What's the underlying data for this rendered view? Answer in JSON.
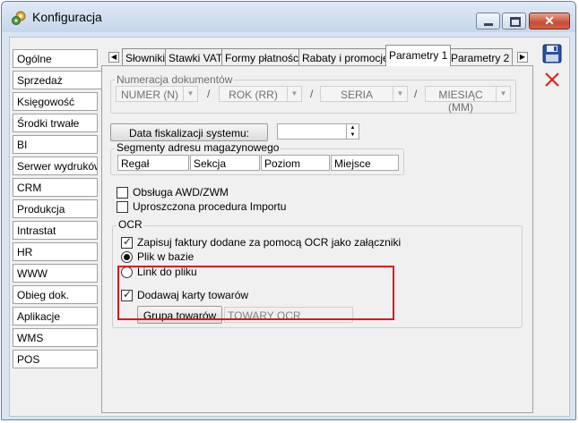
{
  "window": {
    "title": "Konfiguracja",
    "close_label": "✕"
  },
  "sidebar": {
    "items": [
      {
        "label": "Ogólne"
      },
      {
        "label": "Sprzedaż"
      },
      {
        "label": "Księgowość"
      },
      {
        "label": "Środki trwałe"
      },
      {
        "label": "BI"
      },
      {
        "label": "Serwer wydruków"
      },
      {
        "label": "CRM"
      },
      {
        "label": "Produkcja"
      },
      {
        "label": "Intrastat"
      },
      {
        "label": "HR"
      },
      {
        "label": "WWW"
      },
      {
        "label": "Obieg dok."
      },
      {
        "label": "Aplikacje"
      },
      {
        "label": "WMS"
      },
      {
        "label": "POS"
      }
    ],
    "active_index": 1
  },
  "tabs": {
    "prev_arrow": "◀",
    "next_arrow": "▶",
    "items": [
      {
        "label": "Słowniki"
      },
      {
        "label": "Stawki VAT"
      },
      {
        "label": "Formy płatności"
      },
      {
        "label": "Rabaty i promocje"
      },
      {
        "label": "Parametry 1"
      },
      {
        "label": "Parametry 2"
      }
    ],
    "active_index": 4
  },
  "numeracja": {
    "legend": "Numeracja dokumentów",
    "separator": "/",
    "segments": [
      {
        "value": "NUMER (N)"
      },
      {
        "value": "ROK (RR)"
      },
      {
        "value": "SERIA"
      },
      {
        "value": "MIESIĄC (MM)"
      }
    ]
  },
  "fiskalizacja": {
    "button_label": "Data fiskalizacji systemu:",
    "value": ""
  },
  "segmenty": {
    "legend": "Segmenty adresu magazynowego",
    "fields": [
      {
        "value": "Regał"
      },
      {
        "value": "Sekcja"
      },
      {
        "value": "Poziom"
      },
      {
        "value": "Miejsce"
      }
    ]
  },
  "options": {
    "awd_label": "Obsługa AWD/ZWM",
    "awd_checked": false,
    "import_label": "Uproszczona procedura Importu",
    "import_checked": false
  },
  "ocr": {
    "legend": "OCR",
    "save_label": "Zapisuj faktury dodane za pomocą OCR jako załączniki",
    "save_checked": true,
    "radio_file_label": "Plik w bazie",
    "radio_link_label": "Link do pliku",
    "selected_radio": "file",
    "add_cards_label": "Dodawaj karty towarów",
    "add_cards_checked": true,
    "group_button_label": "Grupa towarów",
    "group_value": "TOWARY OCR"
  },
  "colors": {
    "highlight": "#e0141e",
    "title_bg": "#c6d6ea",
    "save_icon": "#2a4fa0",
    "delete_icon": "#d42a1e"
  },
  "icons": {
    "app": "settings-gear-icon",
    "save": "save-disk-icon",
    "delete": "delete-x-icon",
    "minimize": "minimize-icon",
    "maximize": "maximize-icon"
  }
}
